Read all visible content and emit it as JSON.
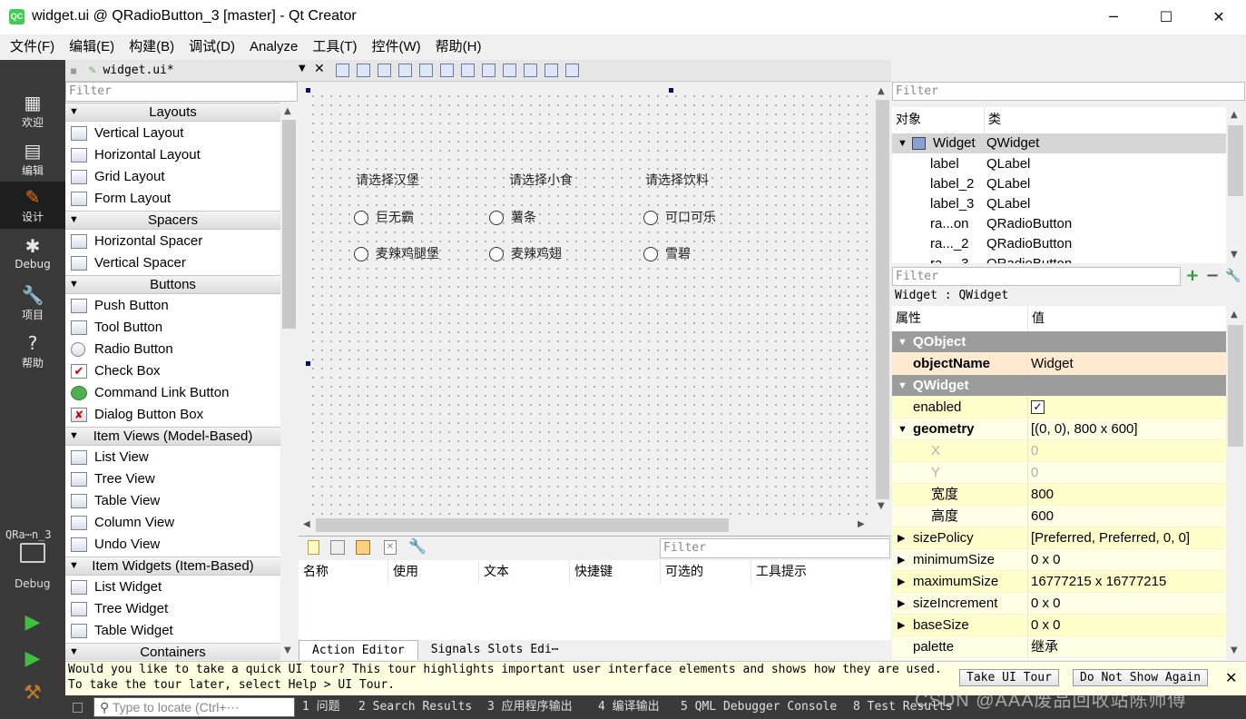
{
  "window": {
    "title": "widget.ui @ QRadioButton_3 [master] - Qt Creator",
    "app_icon": "QC",
    "minimize": "─",
    "maximize": "☐",
    "close": "✕"
  },
  "menu": [
    "文件(F)",
    "编辑(E)",
    "构建(B)",
    "调试(D)",
    "Analyze",
    "工具(T)",
    "控件(W)",
    "帮助(H)"
  ],
  "modes": [
    {
      "label": "欢迎",
      "icon": "grid-icon",
      "glyph": "▦"
    },
    {
      "label": "编辑",
      "icon": "edit-doc-icon",
      "glyph": "▤"
    },
    {
      "label": "设计",
      "icon": "pencil-icon",
      "glyph": "✎"
    },
    {
      "label": "Debug",
      "icon": "bug-icon",
      "glyph": "✱"
    },
    {
      "label": "项目",
      "icon": "wrench-icon",
      "glyph": "🔧"
    },
    {
      "label": "帮助",
      "icon": "help-icon",
      "glyph": "?"
    }
  ],
  "kit": {
    "project": "QRa⋯n_3",
    "config": "Debug"
  },
  "document": {
    "tab": "widget.ui*"
  },
  "widget_box": {
    "filter_placeholder": "Filter",
    "sections": [
      {
        "title": "Layouts",
        "items": [
          "Vertical Layout",
          "Horizontal Layout",
          "Grid Layout",
          "Form Layout"
        ]
      },
      {
        "title": "Spacers",
        "items": [
          "Horizontal Spacer",
          "Vertical Spacer"
        ]
      },
      {
        "title": "Buttons",
        "items": [
          "Push Button",
          "Tool Button",
          "Radio Button",
          "Check Box",
          "Command Link Button",
          "Dialog Button Box"
        ]
      },
      {
        "title": "Item Views (Model-Based)",
        "items": [
          "List View",
          "Tree View",
          "Table View",
          "Column View",
          "Undo View"
        ]
      },
      {
        "title": "Item Widgets (Item-Based)",
        "items": [
          "List Widget",
          "Tree Widget",
          "Table Widget"
        ]
      },
      {
        "title": "Containers",
        "items": []
      }
    ]
  },
  "form": {
    "labels": [
      "请选择汉堡",
      "请选择小食",
      "请选择饮料"
    ],
    "radios": [
      [
        "巨无霸",
        "麦辣鸡腿堡"
      ],
      [
        "薯条",
        "麦辣鸡翅"
      ],
      [
        "可口可乐",
        "雪碧"
      ]
    ]
  },
  "action_editor": {
    "filter_placeholder": "Filter",
    "columns": [
      "名称",
      "使用",
      "文本",
      "快捷键",
      "可选的",
      "工具提示"
    ],
    "tabs": [
      "Action Editor",
      "Signals  Slots Edi⋯"
    ]
  },
  "object_inspector": {
    "filter_placeholder": "Filter",
    "headers": [
      "对象",
      "类"
    ],
    "rows": [
      {
        "name": "Widget",
        "cls": "QWidget"
      },
      {
        "name": "label",
        "cls": "QLabel"
      },
      {
        "name": "label_2",
        "cls": "QLabel"
      },
      {
        "name": "label_3",
        "cls": "QLabel"
      },
      {
        "name": "ra...on",
        "cls": "QRadioButton"
      },
      {
        "name": "ra..._2",
        "cls": "QRadioButton"
      },
      {
        "name": "ra..._3",
        "cls": "QRadioButton"
      }
    ]
  },
  "property_editor": {
    "filter_placeholder": "Filter",
    "class_line": "Widget : QWidget",
    "headers": [
      "属性",
      "值"
    ],
    "rows": [
      {
        "key": "QObject",
        "value": ""
      },
      {
        "key": "objectName",
        "value": "Widget"
      },
      {
        "key": "QWidget",
        "value": ""
      },
      {
        "key": "enabled",
        "value": "✓"
      },
      {
        "key": "geometry",
        "value": "[(0, 0), 800 x 600]"
      },
      {
        "key": "X",
        "value": "0"
      },
      {
        "key": "Y",
        "value": "0"
      },
      {
        "key": "宽度",
        "value": "800"
      },
      {
        "key": "高度",
        "value": "600"
      },
      {
        "key": "sizePolicy",
        "value": "[Preferred, Preferred, 0, 0]"
      },
      {
        "key": "minimumSize",
        "value": "0 x 0"
      },
      {
        "key": "maximumSize",
        "value": "16777215 x 16777215"
      },
      {
        "key": "sizeIncrement",
        "value": "0 x 0"
      },
      {
        "key": "baseSize",
        "value": "0 x 0"
      },
      {
        "key": "palette",
        "value": "继承"
      }
    ]
  },
  "tour": {
    "text": "Would you like to take a quick UI tour? This tour highlights important user interface elements and shows how they are used. To take the tour later, select Help > UI Tour.",
    "take": "Take UI Tour",
    "dismiss": "Do Not Show Again",
    "close": "✕"
  },
  "statusbar": {
    "locate_placeholder": "Type to locate (Ctrl+⋯",
    "panes": [
      "1 问题",
      "2 Search Results",
      "3 应用程序输出",
      "4 编译输出",
      "5 QML Debugger Console",
      "8 Test Results"
    ]
  },
  "watermark": "CSDN @AAA废品回收站陈师傅",
  "colors": {
    "accent_green": "#41cd52",
    "selection_gray": "#d6d6d6",
    "property_yellow": "#ffffcc",
    "group_gray": "#9c9c9c"
  }
}
